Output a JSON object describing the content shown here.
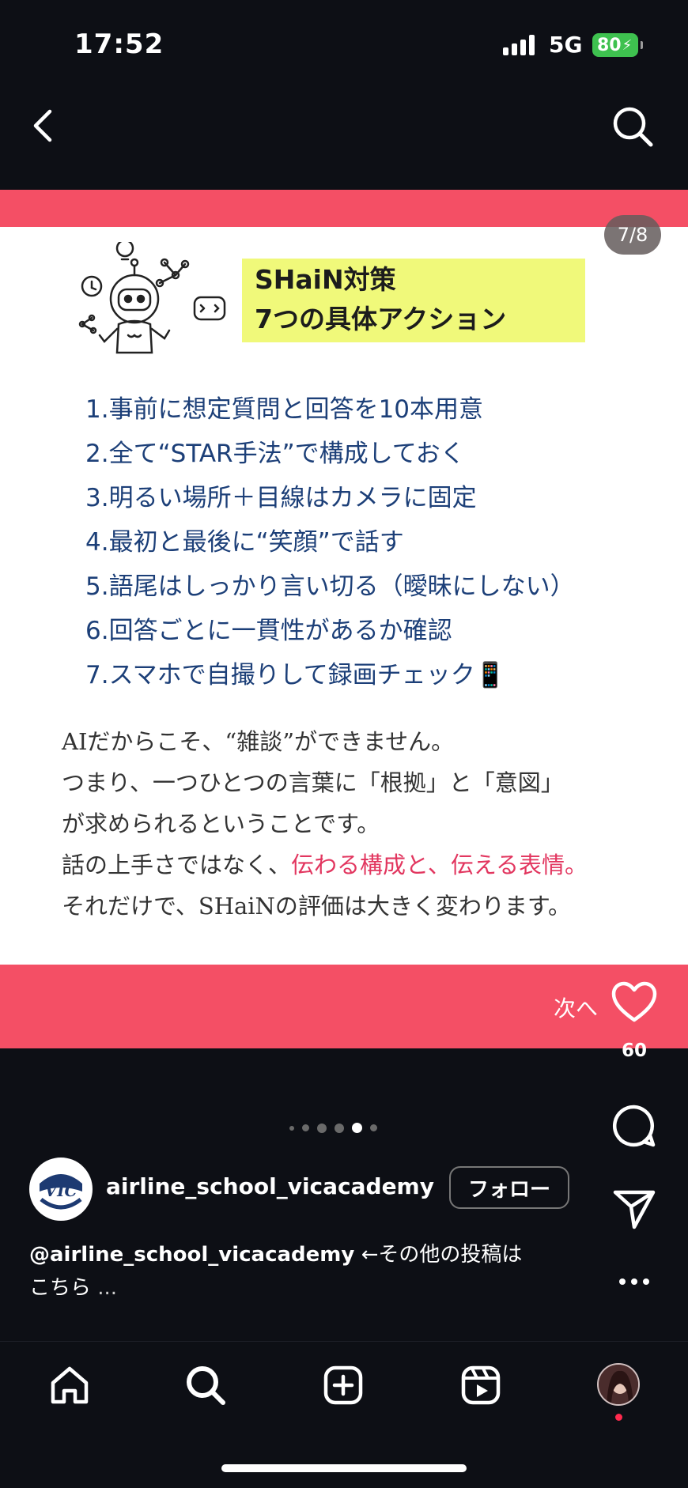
{
  "status_bar": {
    "time": "17:52",
    "network": "5G",
    "battery": "80"
  },
  "post": {
    "page_counter": "7/8",
    "title_line1": "SHaiN対策",
    "title_line2": "7つの具体アクション",
    "actions": [
      "1.事前に想定質問と回答を10本用意",
      "2.全て“STAR手法”で構成しておく",
      "3.明るい場所＋目線はカメラに固定",
      "4.最初と最後に“笑顔”で話す",
      "5.語尾はしっかり言い切る（曖昧にしない）",
      "6.回答ごとに一貫性があるか確認",
      "7.スマホで自撮りして録画チェック📱"
    ],
    "memo": {
      "line1": "AIだからこそ、“雑談”ができません。",
      "line2": "つまり、一つひとつの言葉に「根拠」と「意図」",
      "line3": "が求められるということです。",
      "line4_plain": "話の上手さではなく、",
      "line4_highlight": "伝わる構成と、伝える表情。",
      "line5": "それだけで、SHaiNの評価は大きく変わります。"
    },
    "next_label": "次へ"
  },
  "side_actions": {
    "like_count": "60"
  },
  "carousel": {
    "dot_count": 6,
    "active_index": 4
  },
  "account": {
    "avatar_text": "VIC",
    "username": "airline_school_vicacademy",
    "follow_label": "フォロー"
  },
  "caption": {
    "mention": "@airline_school_vicacademy",
    "text": " ←その他の投稿は",
    "line2": "こちら",
    "more": "..."
  },
  "colors": {
    "accent_pink": "#f44f65",
    "title_bg": "#f0f97a",
    "list_text": "#1c3f78",
    "highlight": "#e2365f",
    "battery_green": "#3ec14f"
  },
  "icons": [
    "back-icon",
    "search-icon",
    "heart-icon",
    "comment-icon",
    "share-icon",
    "more-icon",
    "home-icon",
    "explore-icon",
    "create-icon",
    "reels-icon"
  ]
}
